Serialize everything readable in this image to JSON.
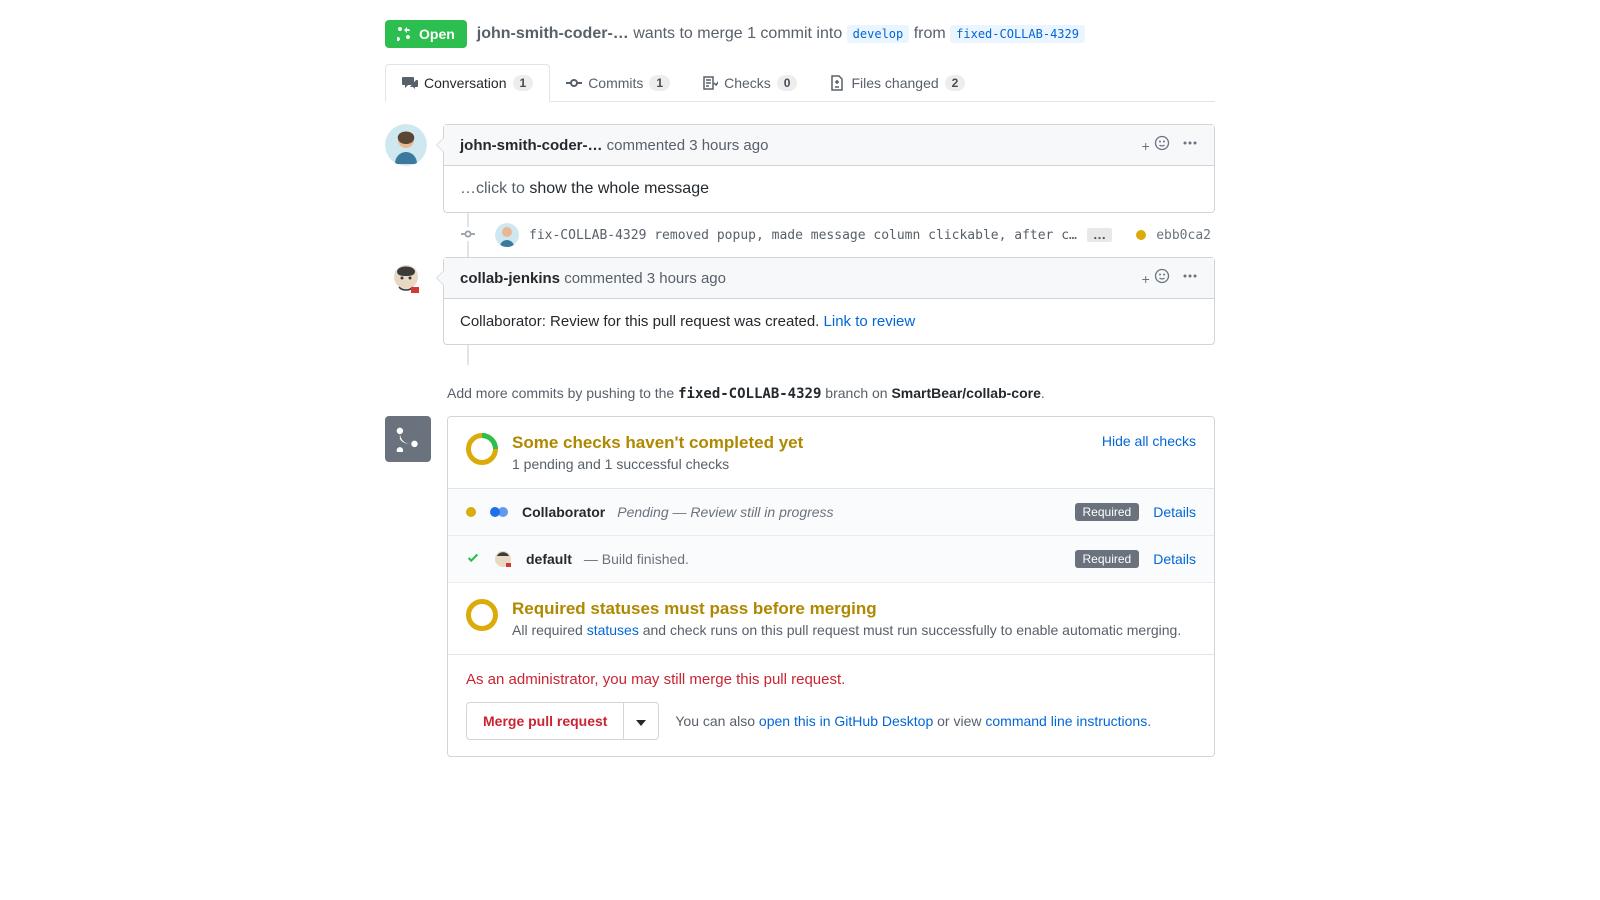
{
  "state": {
    "label": "Open"
  },
  "merge_line": {
    "author": "john-smith-coder-…",
    "verb": "wants to merge",
    "count": "1 commit into",
    "into_branch": "develop",
    "from_word": "from",
    "from_branch": "fixed-COLLAB-4329"
  },
  "tabs": {
    "conversation": {
      "label": "Conversation",
      "count": "1"
    },
    "commits": {
      "label": "Commits",
      "count": "1"
    },
    "checks": {
      "label": "Checks",
      "count": "0"
    },
    "files": {
      "label": "Files changed",
      "count": "2"
    }
  },
  "comments": [
    {
      "author": "john-smith-coder-…",
      "meta": "commented 3 hours ago",
      "body_prefix": "…click to ",
      "body_rest": "show the whole message"
    },
    {
      "author": "collab-jenkins",
      "meta": "commented 3 hours ago",
      "body_text": "Collaborator: Review for this pull request was created. ",
      "body_link": "Link to review"
    }
  ],
  "commit": {
    "message": "fix-COLLAB-4329 removed popup, made message column clickable, after c…",
    "sha": "ebb0ca2"
  },
  "push_hint": {
    "pre": "Add more commits by pushing to the ",
    "branch": "fixed-COLLAB-4329",
    "mid": " branch on ",
    "repo": "SmartBear/collab-core",
    "post": "."
  },
  "checks_panel": {
    "title": "Some checks haven't completed yet",
    "sub": "1 pending and 1 successful checks",
    "hide": "Hide all checks",
    "rows": [
      {
        "name": "Collaborator",
        "status": "Pending — Review still in progress",
        "required": "Required",
        "details": "Details"
      },
      {
        "name": "default",
        "status": " — Build finished.",
        "required": "Required",
        "details": "Details"
      }
    ],
    "req_title": "Required statuses must pass before merging",
    "req_sub_pre": "All required ",
    "req_sub_link": "statuses",
    "req_sub_post": " and check runs on this pull request must run successfully to enable automatic merging."
  },
  "footer": {
    "admin": "As an administrator, you may still merge this pull request.",
    "merge_btn": "Merge pull request",
    "alt_pre": "You can also ",
    "alt_link1": "open this in GitHub Desktop",
    "alt_mid": " or view ",
    "alt_link2": "command line instructions",
    "alt_post": "."
  }
}
